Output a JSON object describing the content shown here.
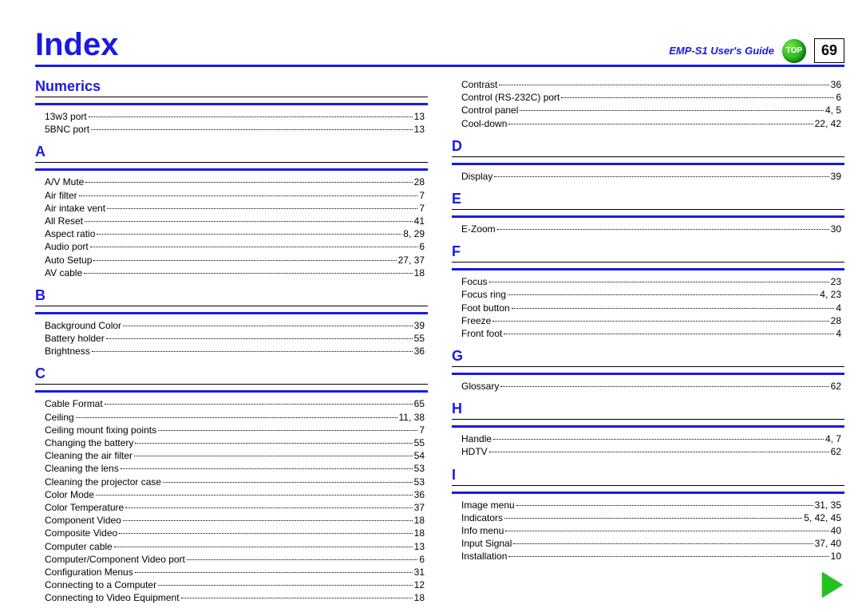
{
  "header": {
    "title": "Index",
    "guide": "EMP-S1 User's Guide",
    "top_label": "TOP",
    "page_number": "69"
  },
  "columns": [
    {
      "sections": [
        {
          "heading": "Numerics",
          "entries": [
            {
              "term": "13w3 port",
              "pages": "13"
            },
            {
              "term": "5BNC port",
              "pages": "13"
            }
          ]
        },
        {
          "heading": "A",
          "entries": [
            {
              "term": "A/V Mute",
              "pages": "28"
            },
            {
              "term": "Air filter",
              "pages": "7"
            },
            {
              "term": "Air intake vent",
              "pages": "7"
            },
            {
              "term": "All Reset",
              "pages": "41"
            },
            {
              "term": "Aspect ratio",
              "pages": "8, 29"
            },
            {
              "term": "Audio port",
              "pages": "6"
            },
            {
              "term": "Auto Setup",
              "pages": "27, 37"
            },
            {
              "term": "AV cable",
              "pages": "18"
            }
          ]
        },
        {
          "heading": "B",
          "entries": [
            {
              "term": "Background Color",
              "pages": "39"
            },
            {
              "term": "Battery holder",
              "pages": "55"
            },
            {
              "term": "Brightness",
              "pages": "36"
            }
          ]
        },
        {
          "heading": "C",
          "entries": [
            {
              "term": "Cable Format",
              "pages": "65"
            },
            {
              "term": "Ceiling",
              "pages": "11, 38"
            },
            {
              "term": "Ceiling mount fixing points",
              "pages": "7"
            },
            {
              "term": "Changing the battery",
              "pages": "55"
            },
            {
              "term": "Cleaning the air filter",
              "pages": "54"
            },
            {
              "term": "Cleaning the lens",
              "pages": "53"
            },
            {
              "term": "Cleaning the projector case",
              "pages": "53"
            },
            {
              "term": "Color Mode",
              "pages": "36"
            },
            {
              "term": "Color Temperature",
              "pages": "37"
            },
            {
              "term": "Component Video",
              "pages": "18"
            },
            {
              "term": "Composite Video",
              "pages": "18"
            },
            {
              "term": "Computer cable",
              "pages": "13"
            },
            {
              "term": "Computer/Component Video port",
              "pages": "6"
            },
            {
              "term": "Configuration Menus",
              "pages": "31"
            },
            {
              "term": "Connecting to a Computer",
              "pages": "12"
            },
            {
              "term": "Connecting to Video Equipment",
              "pages": "18"
            }
          ]
        }
      ]
    },
    {
      "sections": [
        {
          "heading": "",
          "entries": [
            {
              "term": "Contrast",
              "pages": "36"
            },
            {
              "term": "Control (RS-232C) port",
              "pages": "6"
            },
            {
              "term": "Control panel",
              "pages": "4, 5"
            },
            {
              "term": "Cool-down",
              "pages": "22, 42"
            }
          ]
        },
        {
          "heading": "D",
          "entries": [
            {
              "term": "Display",
              "pages": "39"
            }
          ]
        },
        {
          "heading": "E",
          "entries": [
            {
              "term": "E-Zoom",
              "pages": "30"
            }
          ]
        },
        {
          "heading": "F",
          "entries": [
            {
              "term": "Focus",
              "pages": "23"
            },
            {
              "term": "Focus ring",
              "pages": "4, 23"
            },
            {
              "term": "Foot button",
              "pages": "4"
            },
            {
              "term": "Freeze",
              "pages": "28"
            },
            {
              "term": "Front foot",
              "pages": "4"
            }
          ]
        },
        {
          "heading": "G",
          "entries": [
            {
              "term": "Glossary",
              "pages": "62"
            }
          ]
        },
        {
          "heading": "H",
          "entries": [
            {
              "term": "Handle",
              "pages": "4, 7"
            },
            {
              "term": "HDTV",
              "pages": "62"
            }
          ]
        },
        {
          "heading": "I",
          "entries": [
            {
              "term": "Image menu",
              "pages": "31, 35"
            },
            {
              "term": "Indicators",
              "pages": "5, 42, 45"
            },
            {
              "term": "Info menu",
              "pages": "40"
            },
            {
              "term": "Input Signal",
              "pages": "37, 40"
            },
            {
              "term": "Installation",
              "pages": "10"
            }
          ]
        }
      ]
    }
  ]
}
